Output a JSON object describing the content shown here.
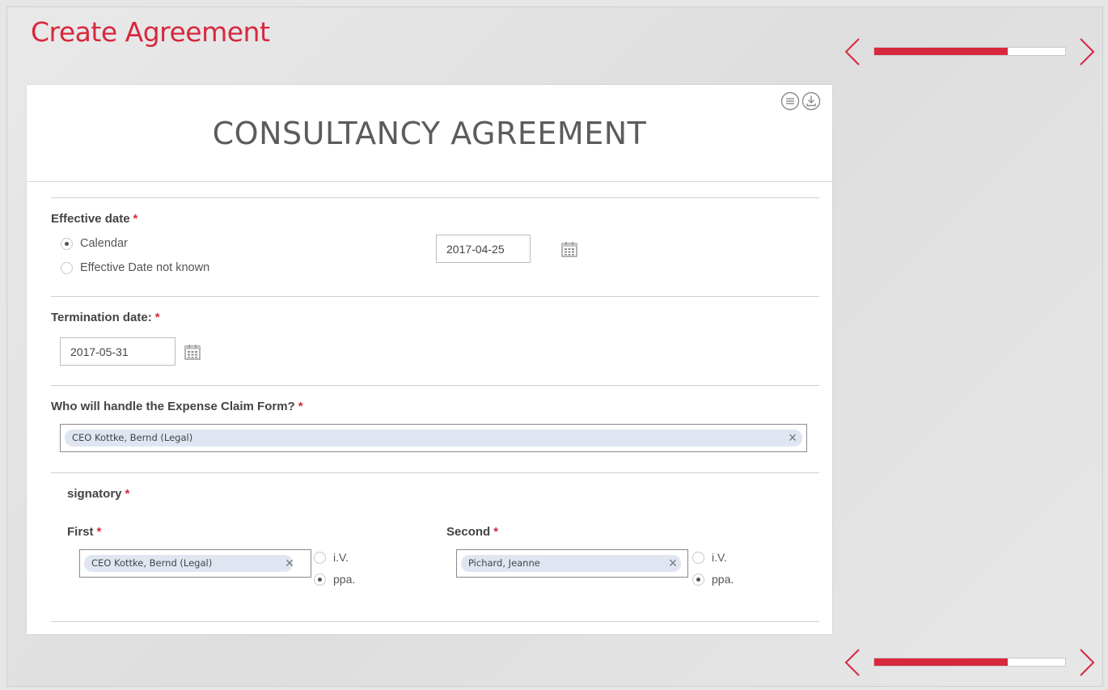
{
  "page": {
    "title": "Create Agreement"
  },
  "progress": {
    "fraction": 0.7,
    "colors": {
      "fill": "#d7283e",
      "track": "#ffffff"
    },
    "icons": {
      "prev": "chevron-left-icon",
      "next": "chevron-right-icon"
    }
  },
  "document": {
    "title": "CONSULTANCY AGREEMENT",
    "icons": {
      "menu": "list-menu-icon",
      "download": "download-icon"
    }
  },
  "effective_date": {
    "label": "Effective date",
    "required_mark": "*",
    "options": [
      {
        "label": "Calendar",
        "checked": true
      },
      {
        "label": "Effective Date not known",
        "checked": false
      }
    ],
    "value": "2017-04-25"
  },
  "termination_date": {
    "label": "Termination date:",
    "required_mark": "*",
    "value": "2017-05-31"
  },
  "expense_claim": {
    "label": "Who will handle the Expense Claim Form?",
    "required_mark": "*",
    "token": "CEO Kottke, Bernd (Legal)",
    "remove_glyph": "×"
  },
  "signatory": {
    "label": "signatory",
    "required_mark": "*",
    "first": {
      "label": "First",
      "required_mark": "*",
      "token": "CEO Kottke, Bernd (Legal)",
      "remove_glyph": "×",
      "options": [
        {
          "label": "i.V.",
          "checked": false
        },
        {
          "label": "ppa.",
          "checked": true
        }
      ]
    },
    "second": {
      "label": "Second",
      "required_mark": "*",
      "token": "Pichard, Jeanne",
      "remove_glyph": "×",
      "options": [
        {
          "label": "i.V.",
          "checked": false
        },
        {
          "label": "ppa.",
          "checked": true
        }
      ]
    }
  },
  "theme": {
    "accent": "#d7283e",
    "token_bg": "#dfe6f1",
    "text": "#444444"
  }
}
